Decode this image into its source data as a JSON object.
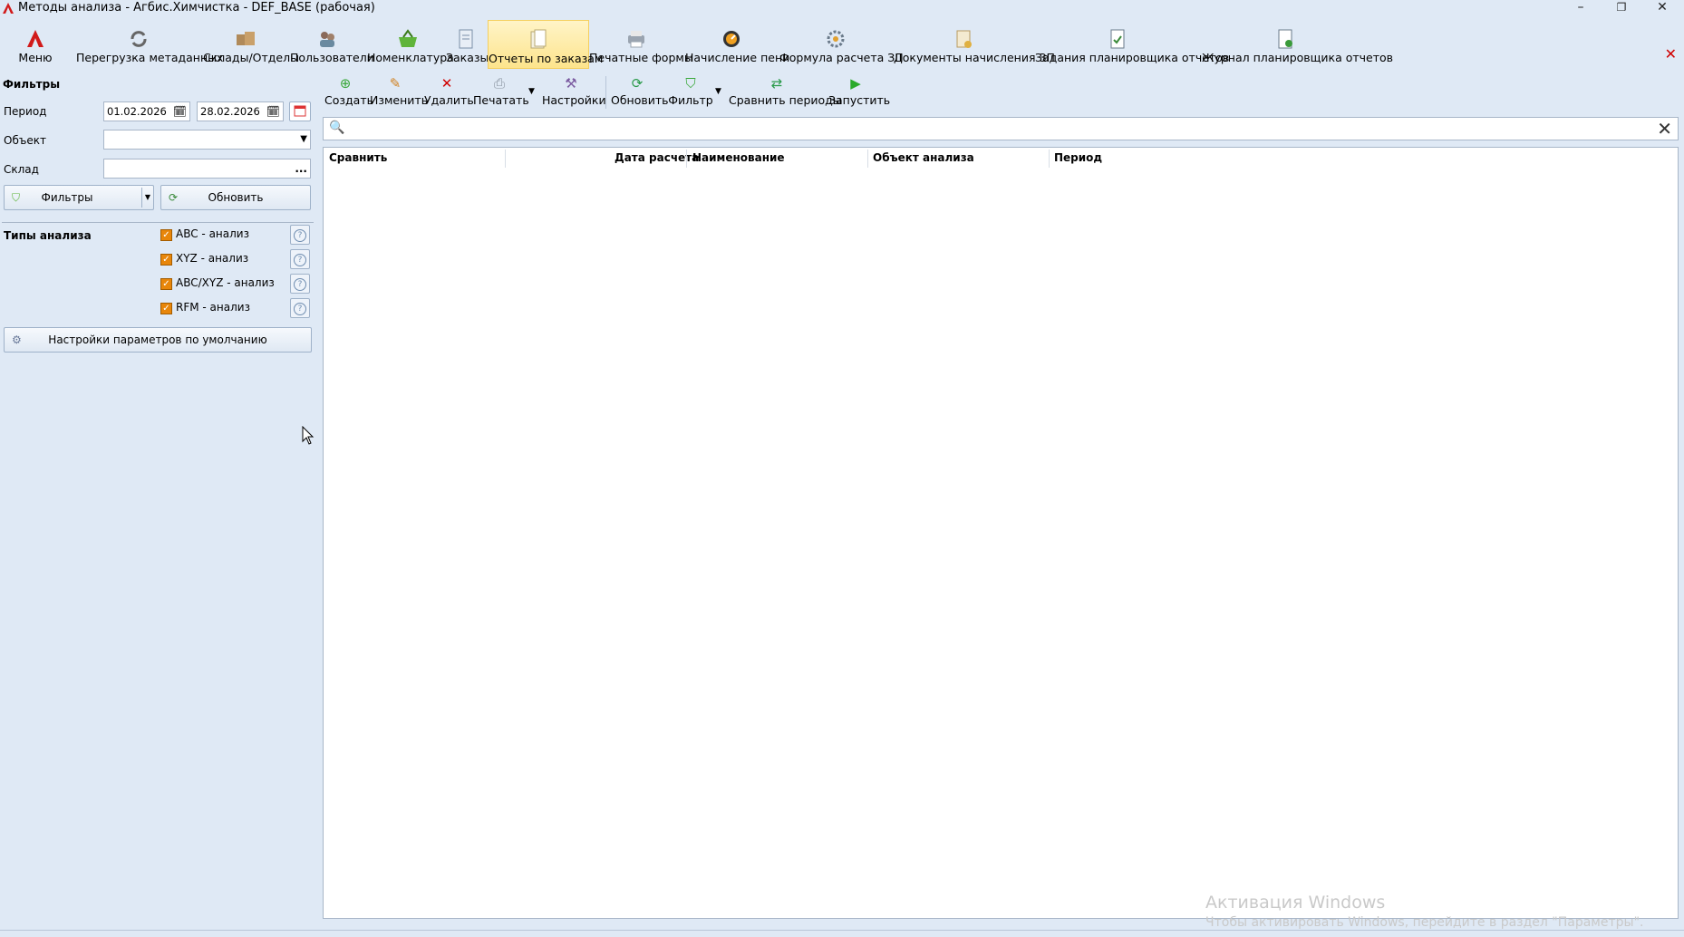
{
  "window": {
    "title": "Методы анализа - Агбис.Химчистка - DEF_BASE (рабочая)",
    "minimize": "–",
    "maximize": "❐",
    "close": "✕"
  },
  "main_toolbar": {
    "items": [
      {
        "label": "Меню",
        "icon": "app-logo-icon"
      },
      {
        "label": "Перегрузка метаданных",
        "icon": "refresh-icon"
      },
      {
        "label": "Склады/Отделы",
        "icon": "warehouse-icon"
      },
      {
        "label": "Пользователи",
        "icon": "users-icon"
      },
      {
        "label": "Номенклатура",
        "icon": "basket-icon"
      },
      {
        "label": "Заказы",
        "icon": "document-icon"
      },
      {
        "label": "Отчеты по заказам",
        "icon": "report-icon"
      },
      {
        "label": "Печатные формы",
        "icon": "printer-icon"
      },
      {
        "label": "Начисление пени",
        "icon": "gauge-icon"
      },
      {
        "label": "Формула расчета ЗП",
        "icon": "formula-icon"
      },
      {
        "label": "Документы начисления ЗП",
        "icon": "salary-docs-icon"
      },
      {
        "label": "Задания планировщика отчетов",
        "icon": "scheduler-task-icon"
      },
      {
        "label": "Журнал планировщика отчетов",
        "icon": "scheduler-log-icon"
      }
    ],
    "close_tab": "✕"
  },
  "filters": {
    "title": "Фильтры",
    "period_label": "Период",
    "period_from": "01.02.2026",
    "period_to": "28.02.2026",
    "object_label": "Объект",
    "object_value": "",
    "warehouse_label": "Склад",
    "warehouse_value": "",
    "warehouse_ellipsis": "...",
    "filters_button": "Фильтры",
    "refresh_button": "Обновить"
  },
  "analysis_types": {
    "title": "Типы анализа",
    "items": [
      {
        "label": "ABC - анализ",
        "checked": true
      },
      {
        "label": "XYZ - анализ",
        "checked": true
      },
      {
        "label": "ABC/XYZ - анализ",
        "checked": true
      },
      {
        "label": "RFM - анализ",
        "checked": true
      }
    ],
    "help_glyph": "?",
    "defaults_button": "Настройки параметров по умолчанию"
  },
  "action_toolbar": {
    "items": [
      {
        "label": "Создать",
        "icon": "add-icon"
      },
      {
        "label": "Изменить",
        "icon": "edit-icon"
      },
      {
        "label": "Удалить",
        "icon": "delete-icon"
      },
      {
        "label": "Печатать",
        "icon": "print-icon"
      },
      {
        "label": "Настройки",
        "icon": "settings-icon"
      },
      {
        "label": "Обновить",
        "icon": "refresh-icon"
      },
      {
        "label": "Фильтр",
        "icon": "filter-icon"
      },
      {
        "label": "Сравнить периоды",
        "icon": "compare-icon"
      },
      {
        "label": "Запустить",
        "icon": "play-icon"
      }
    ]
  },
  "search": {
    "placeholder": "",
    "clear": "✕"
  },
  "grid": {
    "columns": [
      "Сравнить",
      "Дата расчета",
      "Наименование",
      "Объект анализа",
      "Период"
    ],
    "rows": []
  },
  "watermark": {
    "line1": "Активация Windows",
    "line2": "Чтобы активировать Windows, перейдите в раздел \"Параметры\"."
  },
  "colors": {
    "background": "#dfe9f5",
    "active_tab": "#fde48c",
    "checkbox": "#e8860a",
    "close_red": "#d00000"
  }
}
